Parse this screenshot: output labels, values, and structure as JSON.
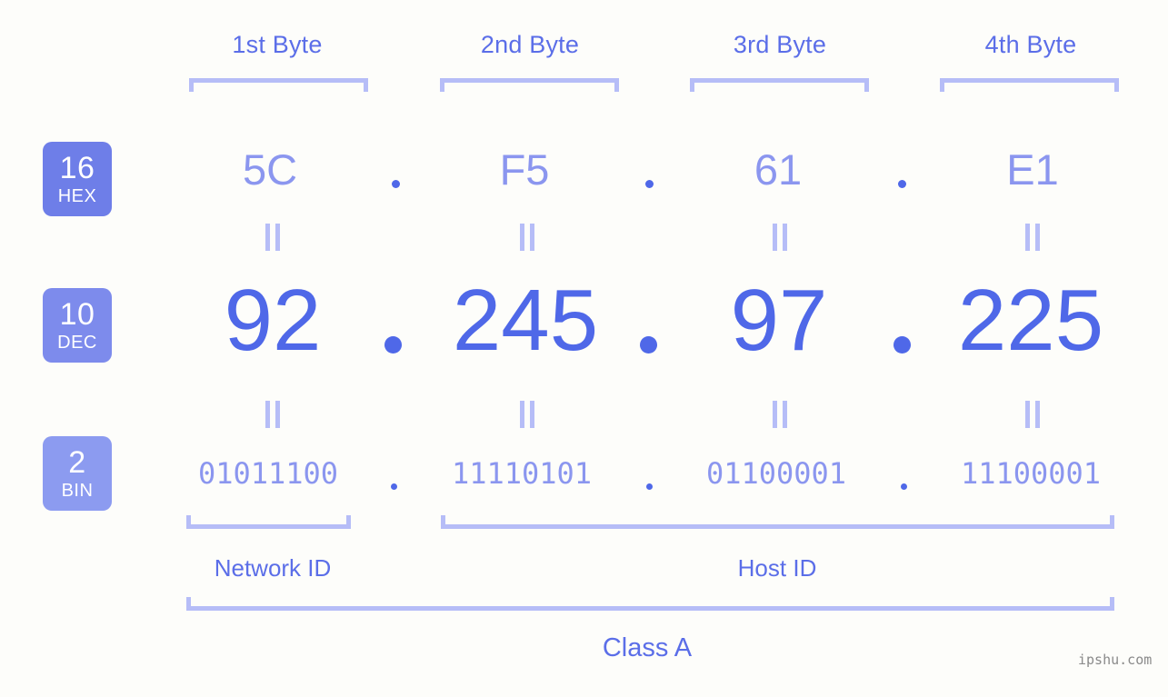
{
  "page": {
    "background_color": "#fdfdfa",
    "accent_color": "#4f68e8",
    "light_accent_color": "#b6bdf7",
    "mid_accent_color": "#8b96ef",
    "watermark": "ipshu.com"
  },
  "byte_headers": [
    {
      "label": "1st Byte"
    },
    {
      "label": "2nd Byte"
    },
    {
      "label": "3rd Byte"
    },
    {
      "label": "4th Byte"
    }
  ],
  "bases": [
    {
      "number": "16",
      "name": "HEX",
      "color": "#6e7ee8"
    },
    {
      "number": "10",
      "name": "DEC",
      "color": "#7d8bec"
    },
    {
      "number": "2",
      "name": "BIN",
      "color": "#8c9bf0"
    }
  ],
  "rows": {
    "hex": {
      "values": [
        "5C",
        "F5",
        "61",
        "E1"
      ],
      "separator": "."
    },
    "dec": {
      "values": [
        "92",
        "245",
        "97",
        "225"
      ],
      "separator": "."
    },
    "bin": {
      "values": [
        "01011100",
        "11110101",
        "01100001",
        "11100001"
      ],
      "separator": "."
    }
  },
  "equals_symbol": "=",
  "regions": [
    {
      "label": "Network ID"
    },
    {
      "label": "Host ID"
    }
  ],
  "ip_class": {
    "label": "Class A"
  }
}
